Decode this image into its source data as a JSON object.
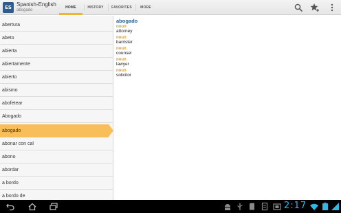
{
  "app": {
    "title": "Spanish-English",
    "subtitle": "abogado",
    "icon_text": "ES",
    "icon": "dictionary-app-icon"
  },
  "tabs": [
    {
      "label": "HOME",
      "selected": true
    },
    {
      "label": "HISTORY",
      "selected": false
    },
    {
      "label": "FAVORITES",
      "selected": false
    },
    {
      "label": "MORE",
      "selected": false
    }
  ],
  "actions": [
    {
      "name": "search-icon"
    },
    {
      "name": "favorite-star-icon"
    },
    {
      "name": "overflow-menu-icon"
    }
  ],
  "word_list": [
    "abertura",
    "abeto",
    "abierta",
    "abiertamente",
    "abierto",
    "abismo",
    "abofetear",
    "Abogado",
    "abogado",
    "abonar con cal",
    "abono",
    "abordar",
    "a bordo",
    "a bordo de"
  ],
  "selected_word": "abogado",
  "entry": {
    "headword": "abogado",
    "senses": [
      {
        "pos": "noun",
        "translation": "attorney"
      },
      {
        "pos": "noun",
        "translation": "barrister"
      },
      {
        "pos": "noun",
        "translation": "counsel"
      },
      {
        "pos": "noun",
        "translation": "lawyer"
      },
      {
        "pos": "noun",
        "translation": "solicitor"
      }
    ]
  },
  "system_bar": {
    "clock": "2:17",
    "accent_color": "#34b5e5"
  },
  "colors": {
    "selection": "#f7be5a",
    "headword": "#2b6197",
    "part_of_speech": "#e59b12",
    "tab_indicator": "#f0b22f"
  }
}
